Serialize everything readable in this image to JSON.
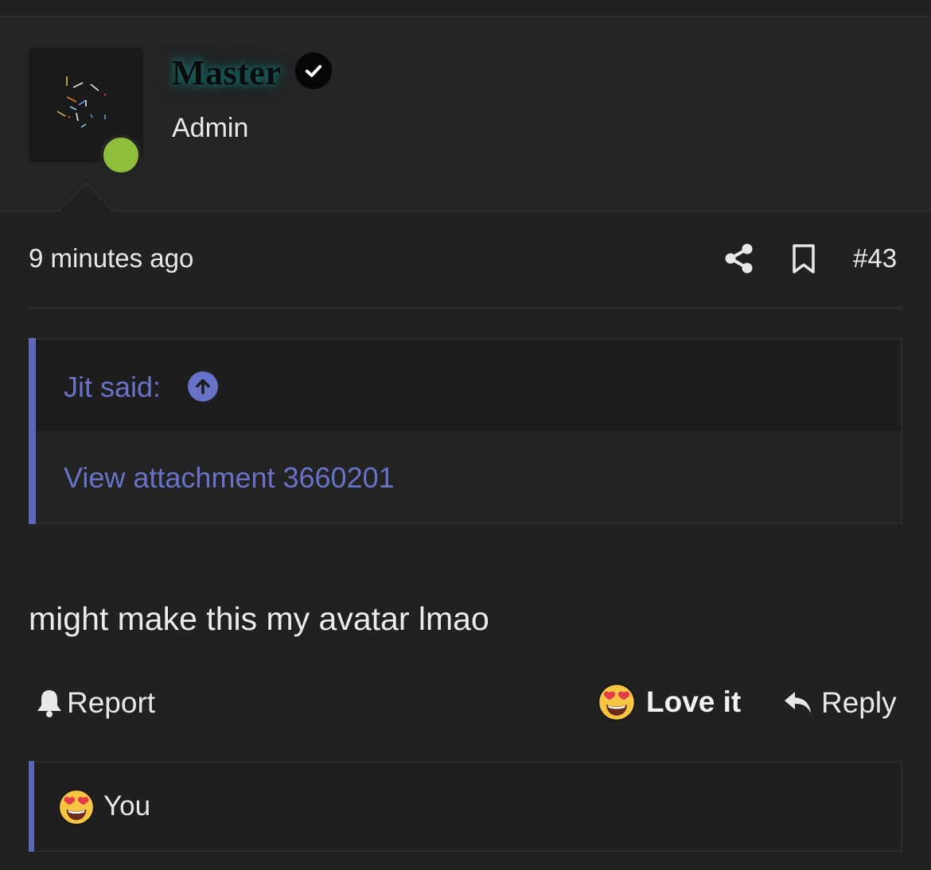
{
  "post": {
    "author": {
      "username": "Master",
      "role": "Admin",
      "online": true,
      "verified_icon": "check-circle-icon"
    },
    "meta": {
      "time": "9 minutes ago",
      "post_number": "#43",
      "share_icon": "share-icon",
      "bookmark_icon": "bookmark-icon"
    },
    "quote": {
      "author_label": "Jit said:",
      "jump_icon": "arrow-up-circle-icon",
      "content_link": "View attachment 3660201"
    },
    "message": "might make this my avatar lmao",
    "actions": {
      "report_label": "Report",
      "love_label": "Love it",
      "reply_label": "Reply"
    },
    "reactions": {
      "emoji": "heart-eyes-emoji",
      "users": "You"
    }
  },
  "colors": {
    "background": "#212121",
    "accent": "#6872c8",
    "online": "#8fbe3a",
    "username_glow": "#1c6f6c"
  }
}
